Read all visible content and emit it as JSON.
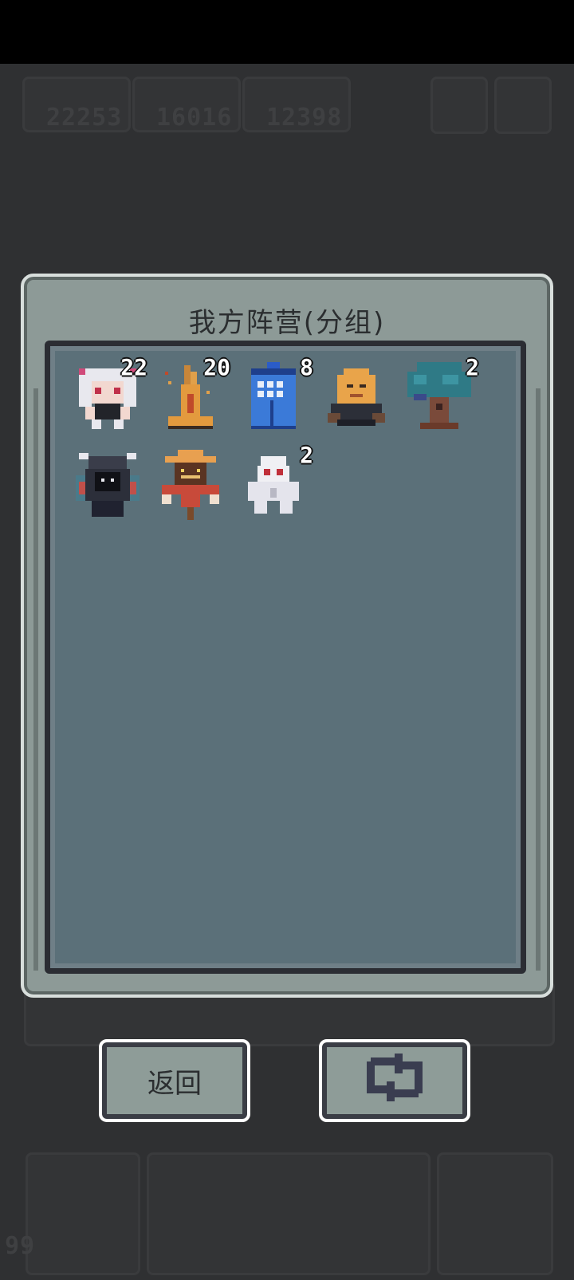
{
  "hud": {
    "resource_1": "22253",
    "resource_2": "16016",
    "resource_3": "12398",
    "level": "99"
  },
  "panel": {
    "title": "我方阵营(分组)"
  },
  "units": [
    {
      "name": "white-haired-girl",
      "count": "22"
    },
    {
      "name": "burning-stump",
      "count": "20"
    },
    {
      "name": "blue-police-box",
      "count": "8"
    },
    {
      "name": "orange-mask-golem",
      "count": ""
    },
    {
      "name": "teal-tree",
      "count": "2"
    },
    {
      "name": "horned-shadow-demon",
      "count": ""
    },
    {
      "name": "straw-hat-scarecrow",
      "count": ""
    },
    {
      "name": "white-ghost",
      "count": "2"
    }
  ],
  "buttons": {
    "back_label": "返回",
    "refresh_icon": "refresh-icon"
  },
  "colors": {
    "panel_bg": "#8d9a97",
    "grid_bg": "#5b7079",
    "button_bg": "#8e9c98"
  }
}
